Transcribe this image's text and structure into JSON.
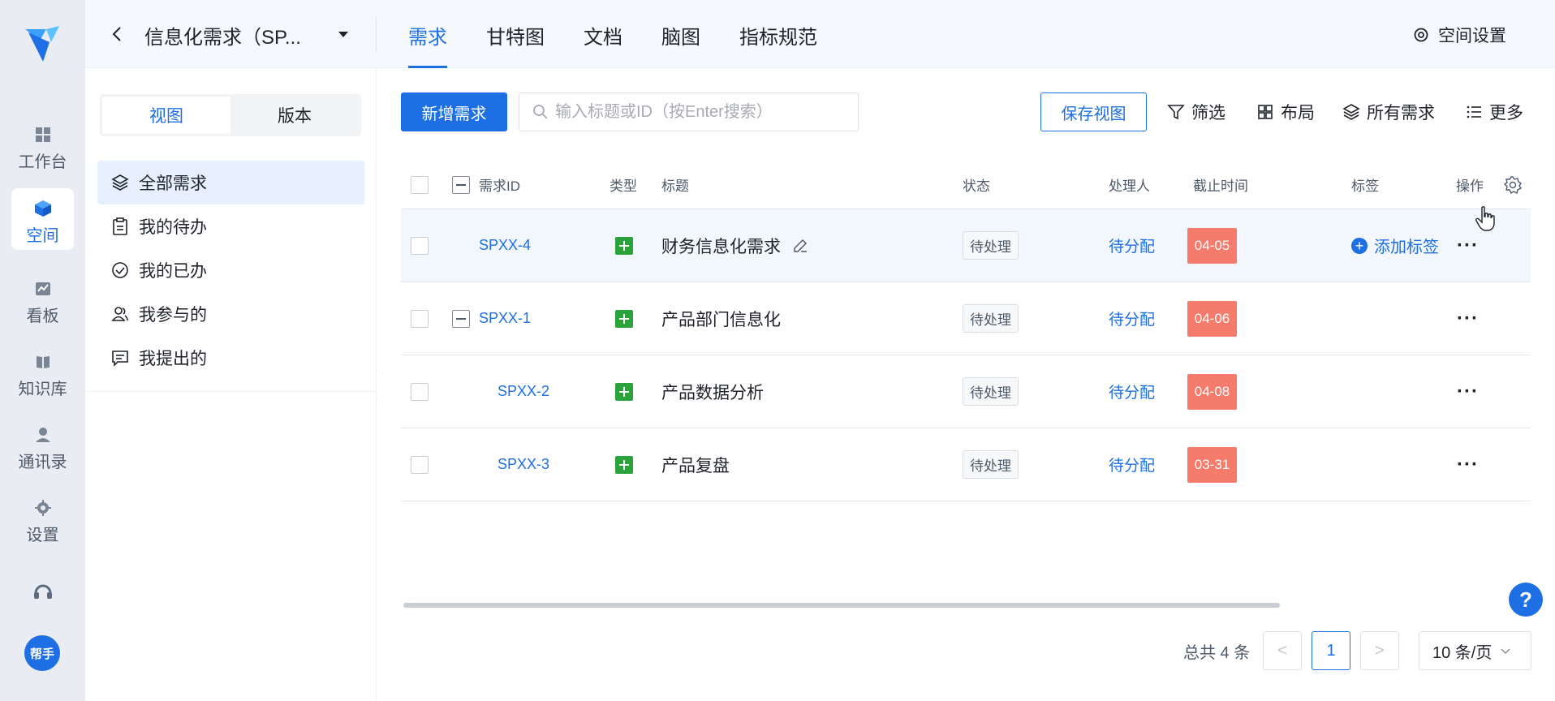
{
  "rail": {
    "items": [
      {
        "label": "工作台",
        "icon": "dashboard-icon"
      },
      {
        "label": "空间",
        "icon": "cube-icon"
      },
      {
        "label": "看板",
        "icon": "chart-board-icon"
      },
      {
        "label": "知识库",
        "icon": "book-icon"
      },
      {
        "label": "通讯录",
        "icon": "contacts-icon"
      },
      {
        "label": "设置",
        "icon": "gear-icon"
      }
    ],
    "helper_label": "帮手"
  },
  "header": {
    "space_title": "信息化需求（SP...",
    "tabs": [
      "需求",
      "甘特图",
      "文档",
      "脑图",
      "指标规范"
    ],
    "active_tab": "需求",
    "space_settings": "空间设置"
  },
  "sidebar": {
    "segments": [
      "视图",
      "版本"
    ],
    "items": [
      {
        "label": "全部需求",
        "icon": "layers-icon"
      },
      {
        "label": "我的待办",
        "icon": "clipboard-icon"
      },
      {
        "label": "我的已办",
        "icon": "check-circle-icon"
      },
      {
        "label": "我参与的",
        "icon": "users-icon"
      },
      {
        "label": "我提出的",
        "icon": "message-icon"
      }
    ]
  },
  "toolbar": {
    "new_label": "新增需求",
    "search_placeholder": "输入标题或ID（按Enter搜索）",
    "save_view": "保存视图",
    "filter": "筛选",
    "layout": "布局",
    "all": "所有需求",
    "more": "更多"
  },
  "table": {
    "columns": [
      "需求ID",
      "类型",
      "标题",
      "状态",
      "处理人",
      "截止时间",
      "标签",
      "操作"
    ],
    "rows": [
      {
        "id": "SPXX-4",
        "title": "财务信息化需求",
        "status": "待处理",
        "assignee": "待分配",
        "due": "04-05",
        "tag_action": "添加标签",
        "more": "···"
      },
      {
        "id": "SPXX-1",
        "title": "产品部门信息化",
        "status": "待处理",
        "assignee": "待分配",
        "due": "04-06",
        "more": "···"
      },
      {
        "id": "SPXX-2",
        "title": "产品数据分析",
        "status": "待处理",
        "assignee": "待分配",
        "due": "04-08",
        "more": "···"
      },
      {
        "id": "SPXX-3",
        "title": "产品复盘",
        "status": "待处理",
        "assignee": "待分配",
        "due": "03-31",
        "more": "···"
      }
    ]
  },
  "pagination": {
    "total": "总共 4 条",
    "prev": "<",
    "current": "1",
    "next": ">",
    "page_size": "10 条/页"
  },
  "help_fab": "?",
  "colors": {
    "primary": "#1e6fe3",
    "due_tag": "#f57b6c",
    "type_green": "#2aa33b"
  }
}
